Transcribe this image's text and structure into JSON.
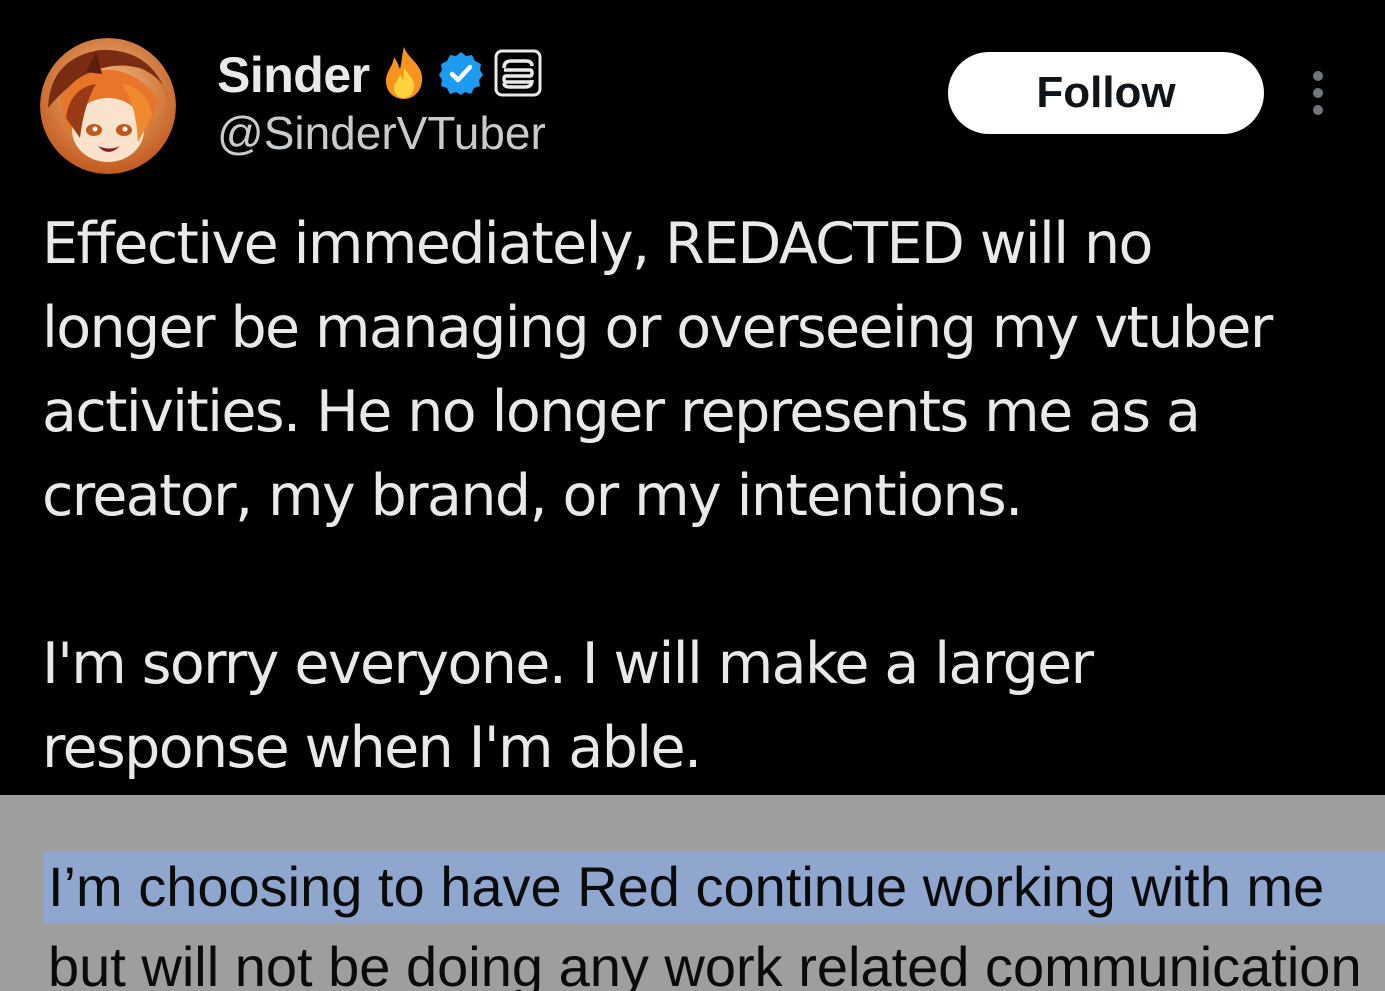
{
  "tweet": {
    "display_name": "Sinder",
    "handle": "@SinderVTuber",
    "badges": [
      "fire-emoji-icon",
      "verified-badge-icon",
      "affiliate-badge-icon"
    ],
    "follow_label": "Follow",
    "more_icon": "more-options-icon",
    "text_lines_p1": [
      "Effective immediately, REDACTED will no",
      "longer be managing or overseeing my vtuber",
      "activities. He no longer represents me as a",
      "creator, my brand, or my intentions."
    ],
    "text_lines_p2": [
      "I'm sorry everyone. I will make a larger",
      "response when I'm able."
    ]
  },
  "document": {
    "line_1": "I’m choosing to have Red continue working with me",
    "line_2": "but will not be doing any work related communication"
  },
  "colors": {
    "tweet_background": "#000000",
    "text": "#e7e9ea",
    "verified_blue": "#1d9bf0",
    "document_background": "#9e9e9e",
    "selection_highlight": "#8fa6cf"
  }
}
